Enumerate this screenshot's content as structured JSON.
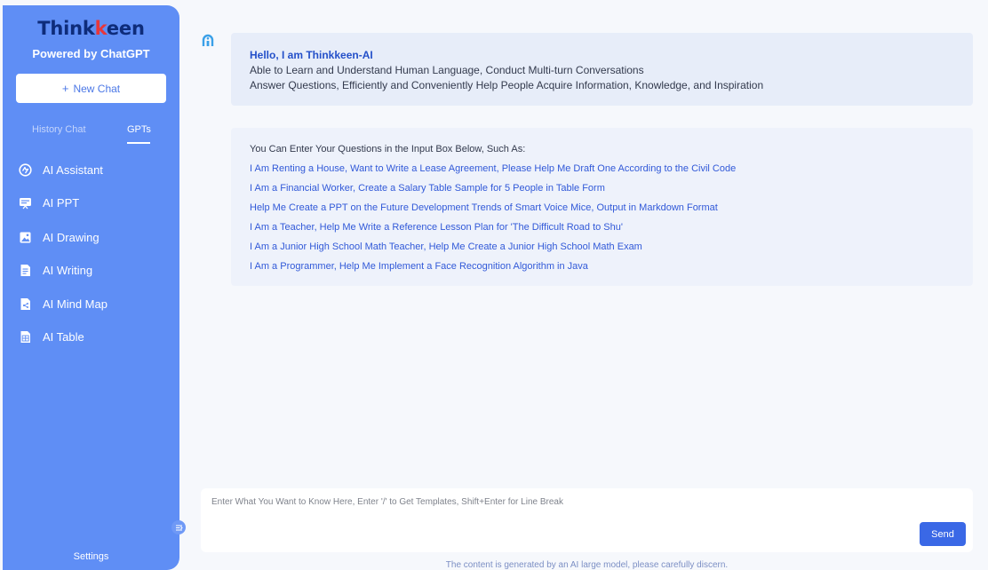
{
  "sidebar": {
    "logo": {
      "prefix": "Think",
      "accent": "k",
      "suffix": "een"
    },
    "tagline": "Powered by ChatGPT",
    "new_chat_label": "New Chat",
    "tabs": [
      {
        "label": "History Chat",
        "active": false
      },
      {
        "label": "GPTs",
        "active": true
      }
    ],
    "items": [
      {
        "label": "AI Assistant",
        "icon": "assistant-icon"
      },
      {
        "label": "AI PPT",
        "icon": "presentation-icon"
      },
      {
        "label": "AI Drawing",
        "icon": "image-icon"
      },
      {
        "label": "AI Writing",
        "icon": "document-icon"
      },
      {
        "label": "AI Mind Map",
        "icon": "mind-map-icon"
      },
      {
        "label": "AI Table",
        "icon": "table-icon"
      }
    ],
    "settings_label": "Settings"
  },
  "welcome": {
    "title": "Hello, I am Thinkkeen-AI",
    "line1": "Able to Learn and Understand Human Language, Conduct Multi-turn Conversations",
    "line2": "Answer Questions, Efficiently and Conveniently Help People Acquire Information, Knowledge, and Inspiration"
  },
  "examples": {
    "intro": "You Can Enter Your Questions in the Input Box Below, Such As:",
    "items": [
      "I Am Renting a House, Want to Write a Lease Agreement, Please Help Me Draft One According to the Civil Code",
      "I Am a Financial Worker, Create a Salary Table Sample for 5 People in Table Form",
      "Help Me Create a PPT on the Future Development Trends of Smart Voice Mice, Output in Markdown Format",
      "I Am a Teacher, Help Me Write a Reference Lesson Plan for 'The Difficult Road to Shu'",
      "I Am a Junior High School Math Teacher, Help Me Create a Junior High School Math Exam",
      "I Am a Programmer, Help Me Implement a Face Recognition Algorithm in Java"
    ]
  },
  "input": {
    "placeholder": "Enter What You Want to Know Here, Enter '/' to Get Templates, Shift+Enter for Line Break",
    "value": "",
    "send_label": "Send"
  },
  "disclaimer": "The content is generated by an AI large model, please carefully discern.",
  "colors": {
    "sidebar_bg": "#5f8ef5",
    "accent": "#3a68e6",
    "link": "#3159d8",
    "logo_dark": "#0e2c7a",
    "logo_red": "#e8363a"
  }
}
